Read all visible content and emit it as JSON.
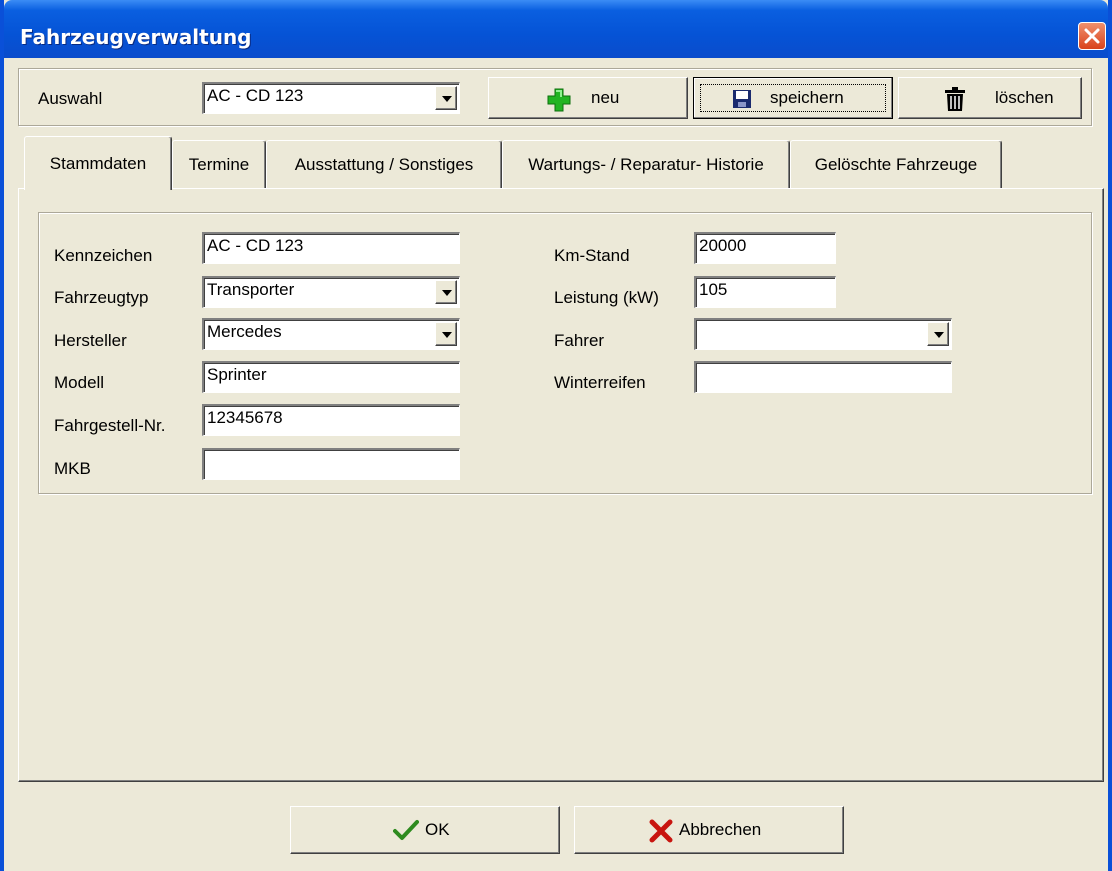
{
  "window": {
    "title": "Fahrzeugverwaltung"
  },
  "toolbar": {
    "auswahl_label": "Auswahl",
    "auswahl_value": "AC - CD 123",
    "neu_label": "neu",
    "speichern_label": "speichern",
    "loeschen_label": "löschen"
  },
  "tabs": [
    {
      "label": "Stammdaten",
      "active": true
    },
    {
      "label": "Termine",
      "active": false
    },
    {
      "label": "Ausstattung / Sonstiges",
      "active": false
    },
    {
      "label": "Wartungs- / Reparatur- Historie",
      "active": false
    },
    {
      "label": "Gelöschte Fahrzeuge",
      "active": false
    }
  ],
  "stammdaten": {
    "kennzeichen_label": "Kennzeichen",
    "kennzeichen_value": "AC - CD 123",
    "fahrzeugtyp_label": "Fahrzeugtyp",
    "fahrzeugtyp_value": "Transporter",
    "hersteller_label": "Hersteller",
    "hersteller_value": "Mercedes",
    "modell_label": "Modell",
    "modell_value": "Sprinter",
    "fahrgestell_label": "Fahrgestell-Nr.",
    "fahrgestell_value": "12345678",
    "mkb_label": "MKB",
    "mkb_value": "",
    "kmstand_label": "Km-Stand",
    "kmstand_value": "20000",
    "leistung_label": "Leistung (kW)",
    "leistung_value": "105",
    "fahrer_label": "Fahrer",
    "fahrer_value": "",
    "winterreifen_label": "Winterreifen",
    "winterreifen_value": ""
  },
  "footer": {
    "ok_label": "OK",
    "abbrechen_label": "Abbrechen"
  },
  "icons": {
    "neu": "plus-icon",
    "speichern": "floppy-disk-icon",
    "loeschen": "trash-can-icon",
    "ok": "checkmark-icon",
    "abbrechen": "x-mark-icon",
    "close": "close-icon"
  },
  "colors": {
    "titlebar": "#0553d6",
    "face": "#ece9d8",
    "close": "#d9431c",
    "ok_check": "#2e8b1f",
    "cancel_x": "#c8150f",
    "plus": "#22b422"
  }
}
